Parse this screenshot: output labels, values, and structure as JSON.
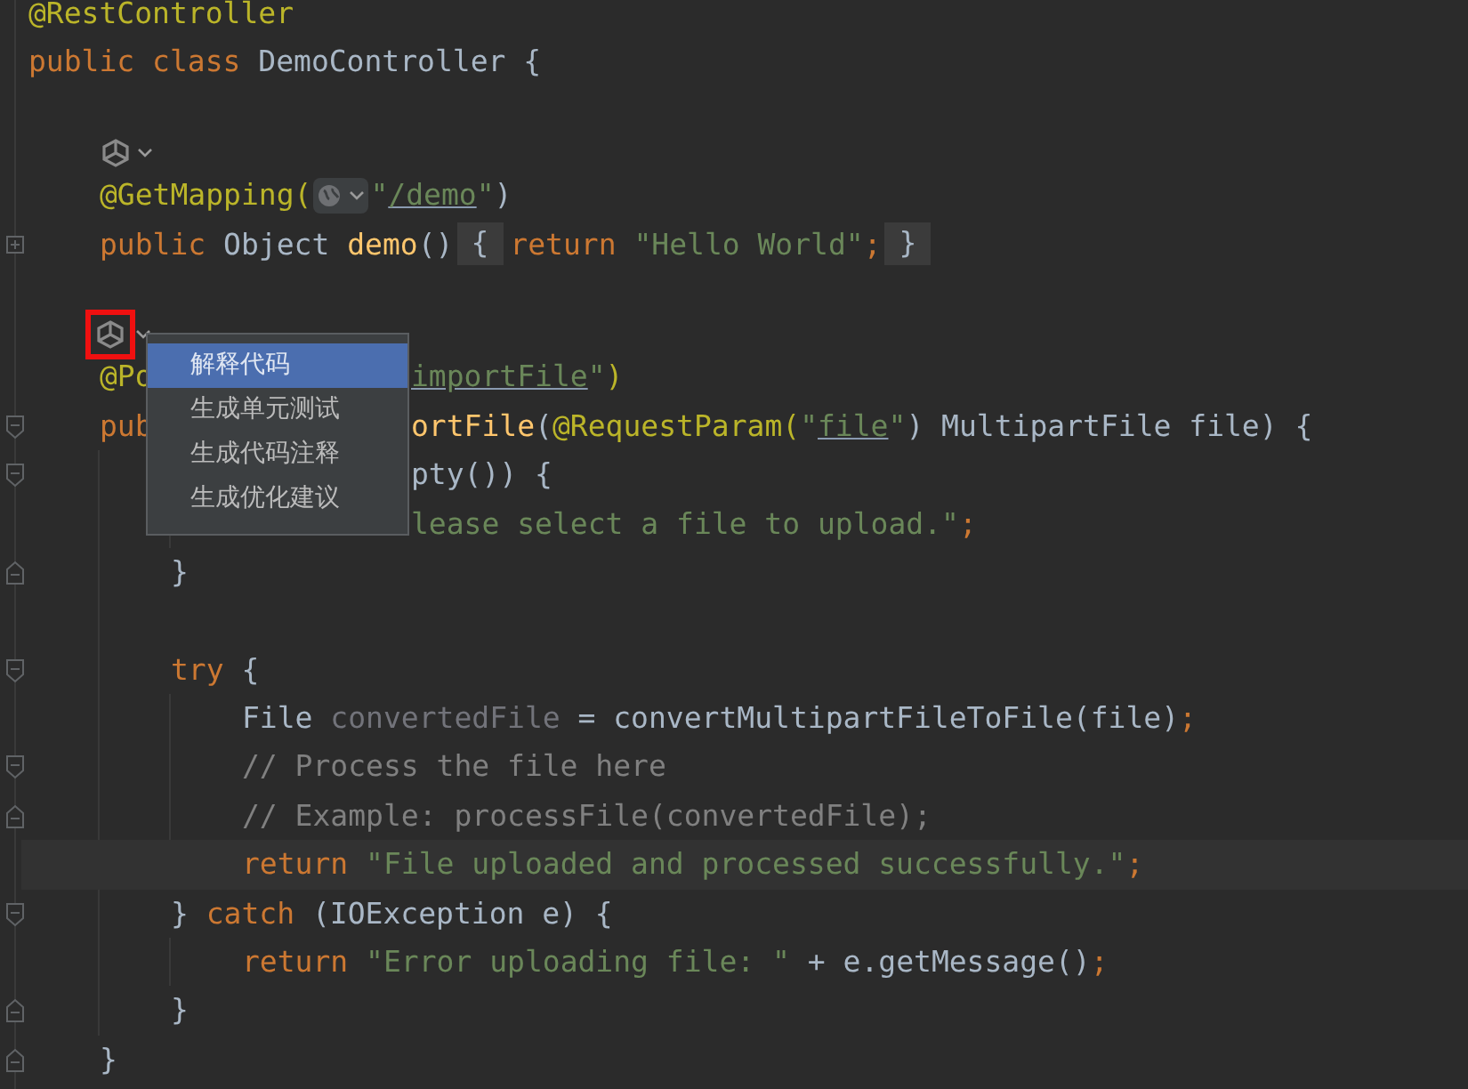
{
  "editor": {
    "lines": [
      {
        "kind": "code",
        "tokens": [
          {
            "kind": "annotation",
            "text": "@RestController"
          }
        ]
      },
      {
        "kind": "code",
        "tokens": [
          {
            "kind": "keyword",
            "text": "public class "
          },
          {
            "kind": "plain",
            "text": "DemoController {"
          }
        ],
        "children": [
          {
            "kind": "blank"
          },
          {
            "kind": "inlay",
            "highlighted": false
          },
          {
            "kind": "code",
            "tokens": [
              {
                "kind": "annotation",
                "text": "@GetMapping("
              },
              {
                "kind": "globe"
              },
              {
                "kind": "string",
                "text": "\""
              },
              {
                "kind": "link",
                "text": "/demo"
              },
              {
                "kind": "string",
                "text": "\""
              },
              {
                "kind": "plain",
                "text": ")"
              }
            ]
          },
          {
            "kind": "code",
            "collapsed": true,
            "tokens": [
              {
                "kind": "keyword",
                "text": "public "
              },
              {
                "kind": "plain",
                "text": "Object "
              },
              {
                "kind": "method",
                "text": "demo"
              },
              {
                "kind": "plain",
                "text": "()"
              },
              {
                "kind": "folded",
                "text": "{"
              },
              {
                "kind": "keyword",
                "text": "return "
              },
              {
                "kind": "string",
                "text": "\"Hello World\""
              },
              {
                "kind": "semi",
                "text": ";"
              },
              {
                "kind": "folded",
                "text": "}"
              }
            ]
          },
          {
            "kind": "blank"
          },
          {
            "kind": "inlay",
            "highlighted": true
          },
          {
            "kind": "code",
            "tokens": [
              {
                "kind": "annotation",
                "text": "@Po"
              }
            ],
            "tail": [
              {
                "kind": "link",
                "text": "importFile"
              },
              {
                "kind": "string",
                "text": "\""
              },
              {
                "kind": "annotation",
                "text": ")"
              }
            ]
          },
          {
            "kind": "code",
            "fold_start": true,
            "tokens": [
              {
                "kind": "keyword",
                "text": "pub"
              }
            ],
            "tail": [
              {
                "kind": "method",
                "text": "ortFile"
              },
              {
                "kind": "plain",
                "text": "("
              },
              {
                "kind": "annotation",
                "text": "@RequestParam("
              },
              {
                "kind": "string",
                "text": "\""
              },
              {
                "kind": "link",
                "text": "file"
              },
              {
                "kind": "string",
                "text": "\""
              },
              {
                "kind": "plain",
                "text": ") MultipartFile file) {"
              }
            ],
            "children": [
              {
                "kind": "code",
                "fold_start": true,
                "tail": [
                  {
                    "kind": "plain",
                    "text": "pty()) {"
                  }
                ],
                "children": [
                  {
                    "kind": "code",
                    "tail": [
                      {
                        "kind": "string",
                        "text": "lease select a file to upload.\""
                      },
                      {
                        "kind": "semi",
                        "text": ";"
                      }
                    ]
                  }
                ]
              },
              {
                "kind": "code",
                "fold_end": true,
                "tokens": [
                  {
                    "kind": "plain",
                    "text": "}"
                  }
                ]
              },
              {
                "kind": "blank"
              },
              {
                "kind": "code",
                "fold_start": true,
                "tokens": [
                  {
                    "kind": "keyword",
                    "text": "try "
                  },
                  {
                    "kind": "plain",
                    "text": "{"
                  }
                ],
                "children": [
                  {
                    "kind": "code",
                    "tokens": [
                      {
                        "kind": "plain",
                        "text": "File "
                      },
                      {
                        "kind": "unused",
                        "text": "convertedFile"
                      },
                      {
                        "kind": "plain",
                        "text": " = convertMultipartFileToFile(file)"
                      },
                      {
                        "kind": "semi",
                        "text": ";"
                      }
                    ]
                  },
                  {
                    "kind": "code",
                    "fold_start": true,
                    "tokens": [
                      {
                        "kind": "comment",
                        "text": "// Process the file here"
                      }
                    ]
                  },
                  {
                    "kind": "code",
                    "fold_end": true,
                    "tokens": [
                      {
                        "kind": "comment",
                        "text": "// Example: processFile(convertedFile);"
                      }
                    ]
                  },
                  {
                    "kind": "code",
                    "current": true,
                    "tokens": [
                      {
                        "kind": "keyword",
                        "text": "return "
                      },
                      {
                        "kind": "string",
                        "text": "\"File uploaded and processed successfully.\""
                      },
                      {
                        "kind": "semi",
                        "text": ";"
                      }
                    ]
                  }
                ]
              },
              {
                "kind": "code",
                "fold_start": true,
                "tokens": [
                  {
                    "kind": "plain",
                    "text": "} "
                  },
                  {
                    "kind": "keyword",
                    "text": "catch "
                  },
                  {
                    "kind": "plain",
                    "text": "(IOException e) {"
                  }
                ],
                "children": [
                  {
                    "kind": "code",
                    "tokens": [
                      {
                        "kind": "keyword",
                        "text": "return "
                      },
                      {
                        "kind": "string",
                        "text": "\"Error uploading file: \""
                      },
                      {
                        "kind": "plain",
                        "text": " + e.getMessage()"
                      },
                      {
                        "kind": "semi",
                        "text": ";"
                      }
                    ]
                  }
                ]
              },
              {
                "kind": "code",
                "fold_end": true,
                "tokens": [
                  {
                    "kind": "plain",
                    "text": "}"
                  }
                ]
              }
            ]
          },
          {
            "kind": "code",
            "fold_end": true,
            "tokens": [
              {
                "kind": "plain",
                "text": "}"
              }
            ]
          }
        ]
      }
    ]
  },
  "popup_menu": {
    "items": [
      {
        "label": "解释代码",
        "selected": true
      },
      {
        "label": "生成单元测试",
        "selected": false
      },
      {
        "label": "生成代码注释",
        "selected": false
      },
      {
        "label": "生成优化建议",
        "selected": false
      }
    ]
  }
}
